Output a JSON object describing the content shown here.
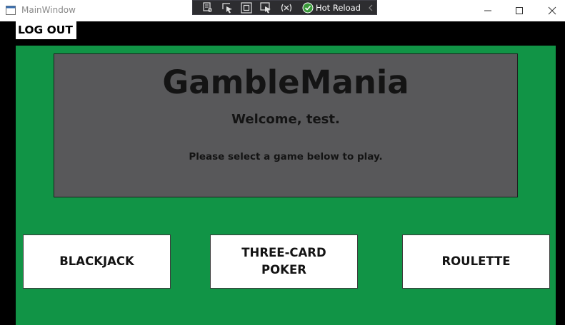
{
  "window": {
    "title": "MainWindow"
  },
  "dev_toolbar": {
    "hot_reload_label": "Hot Reload",
    "icons": [
      "live-visual-tree-icon",
      "select-element-icon",
      "display-layout-adorners-icon",
      "track-focus-icon",
      "binding-failures-icon",
      "hot-reload-check-icon",
      "collapse-chevron-icon"
    ]
  },
  "header": {
    "logout_label": "LOG OUT"
  },
  "main": {
    "app_title": "GambleMania",
    "welcome": "Welcome, test.",
    "instruction": "Please select a game below to play."
  },
  "games": {
    "blackjack": "BLACKJACK",
    "poker_line1": "THREE-CARD",
    "poker_line2": "POKER",
    "roulette": "ROULETTE"
  },
  "colors": {
    "table_green": "#119446",
    "panel_gray": "#58585a",
    "background": "#000000",
    "hot_reload_green": "#3a9a3a"
  }
}
